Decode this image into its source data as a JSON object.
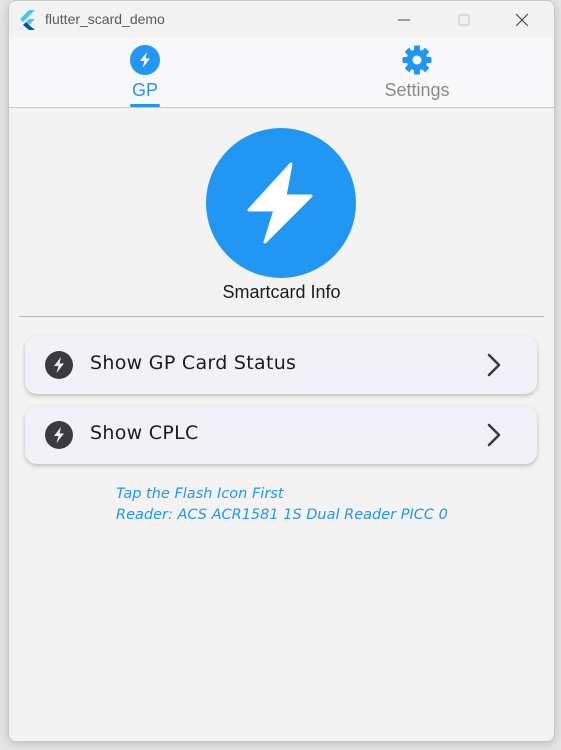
{
  "window": {
    "title": "flutter_scard_demo",
    "icons": {
      "logo": "flutter-logo-icon",
      "minimize": "minimize-icon",
      "maximize": "maximize-icon",
      "close": "close-icon"
    }
  },
  "tabs": [
    {
      "label": "GP",
      "icon": "flash-icon",
      "selected": true
    },
    {
      "label": "Settings",
      "icon": "gear-icon",
      "selected": false
    }
  ],
  "hero": {
    "label": "Smartcard Info",
    "icon": "flash-icon"
  },
  "actions": [
    {
      "label": "Show GP Card Status",
      "icon": "flash-icon",
      "trailing_icon": "chevron-right-icon"
    },
    {
      "label": "Show CPLC",
      "icon": "flash-icon",
      "trailing_icon": "chevron-right-icon"
    }
  ],
  "info": {
    "hint": "Tap the Flash Icon First",
    "reader": "Reader: ACS ACR1581 1S Dual Reader PICC 0"
  },
  "colors": {
    "accent": "#2196f3",
    "inactive_tab": "#8a8a8a",
    "background": "#f3f3f3",
    "card_background": "#f1f1f7",
    "icon_dark": "#3a3b40"
  }
}
